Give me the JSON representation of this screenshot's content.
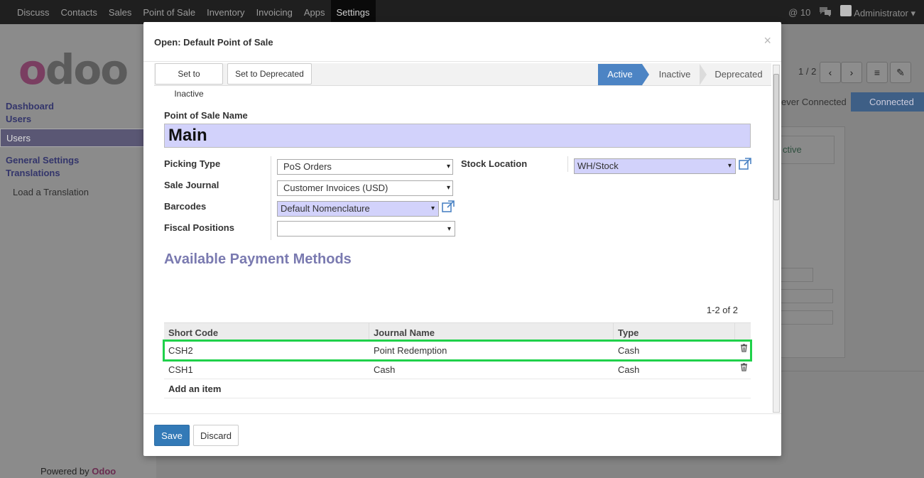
{
  "topnav": {
    "items": [
      "Discuss",
      "Contacts",
      "Sales",
      "Point of Sale",
      "Inventory",
      "Invoicing",
      "Apps",
      "Settings"
    ],
    "active": "Settings",
    "notif_count": "10",
    "user": "Administrator ▾"
  },
  "sidebar": {
    "logo": "odoo",
    "sections": [
      {
        "title": "Dashboard"
      },
      {
        "title": "Users",
        "items": [
          "Users"
        ]
      },
      {
        "title": "General Settings"
      },
      {
        "title": "Translations",
        "items": [
          "Load a Translation"
        ]
      }
    ],
    "powered_prefix": "Powered by",
    "powered_brand": "Odoo"
  },
  "background": {
    "pager": "1 / 2",
    "stage_prev": "ever Connected",
    "stage_next": "Connected",
    "sheet_text": "ctive"
  },
  "modal": {
    "title": "Open: Default Point of Sale",
    "close": "×",
    "buttons": {
      "inactive": "Set to Inactive",
      "deprecated": "Set to Deprecated"
    },
    "stages": [
      "Active",
      "Inactive",
      "Deprecated"
    ],
    "active_stage": "Active",
    "form": {
      "name_label": "Point of Sale Name",
      "name_value": "Main",
      "picking_type_label": "Picking Type",
      "picking_type_value": "PoS Orders",
      "sale_journal_label": "Sale Journal",
      "sale_journal_value": "Customer Invoices (USD)",
      "barcodes_label": "Barcodes",
      "barcodes_value": "Default Nomenclature",
      "fiscal_positions_label": "Fiscal Positions",
      "fiscal_positions_value": "",
      "stock_location_label": "Stock Location",
      "stock_location_value": "WH/Stock"
    },
    "payment": {
      "section_title": "Available Payment Methods",
      "pager": "1-2 of 2",
      "columns": [
        "Short Code",
        "Journal Name",
        "Type"
      ],
      "rows": [
        {
          "code": "CSH2",
          "journal": "Point Redemption",
          "type": "Cash"
        },
        {
          "code": "CSH1",
          "journal": "Cash",
          "type": "Cash"
        }
      ],
      "add_item": "Add an item"
    },
    "footer": {
      "save": "Save",
      "discard": "Discard"
    }
  },
  "colors": {
    "accent": "#337ab7",
    "stage_active": "#4c84c4",
    "highlight": "#1fd14a",
    "required_field": "#d2d2fb"
  }
}
